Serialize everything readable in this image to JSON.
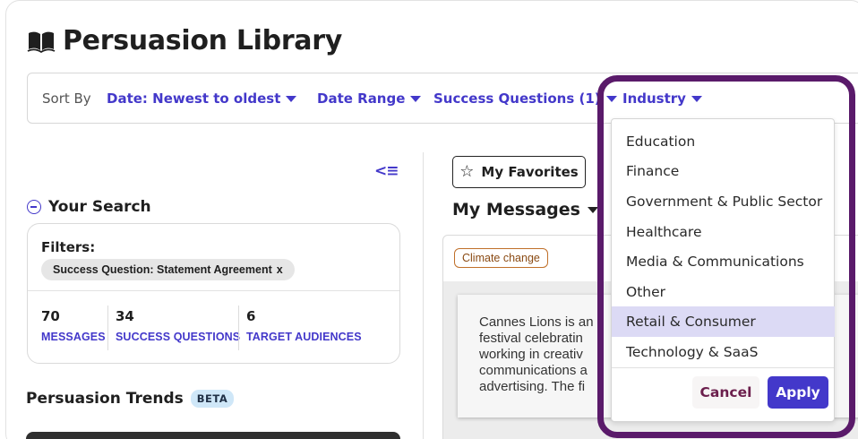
{
  "page": {
    "title": "Persuasion Library"
  },
  "toolbar": {
    "sort_label": "Sort By",
    "sort_value": "Date: Newest to oldest",
    "date_range": "Date Range",
    "success_questions": "Success Questions (1)",
    "industry": "Industry"
  },
  "sidebar": {
    "your_search": "Your Search",
    "filters_label": "Filters:",
    "filter_chip": "Success Question: Statement Agreement",
    "filter_chip_remove": "x",
    "stats": [
      {
        "value": "70",
        "label": "MESSAGES"
      },
      {
        "value": "34",
        "label": "SUCCESS QUESTIONS"
      },
      {
        "value": "6",
        "label": "TARGET AUDIENCES"
      }
    ],
    "trends_title": "Persuasion Trends",
    "trends_badge": "BETA"
  },
  "main": {
    "favorites_label": "My Favorites",
    "messages_title": "My Messages",
    "card": {
      "tag": "Climate change",
      "text": "Cannes Lions is an\nfestival celebratin\nworking in creativ\ncommunications a\nadvertising. The fi"
    }
  },
  "industry_dropdown": {
    "options": [
      "Education",
      "Finance",
      "Government & Public Sector",
      "Healthcare",
      "Media & Communications",
      "Other",
      "Retail & Consumer",
      "Technology & SaaS"
    ],
    "highlighted_option": "Retail & Consumer",
    "cancel_label": "Cancel",
    "apply_label": "Apply"
  },
  "colors": {
    "accent": "#4338ca",
    "highlight_border": "#5a1a6a",
    "selected_option_bg": "#dcdaf5",
    "tag_border": "#c0702a",
    "cancel_text": "#6b1e4c"
  }
}
